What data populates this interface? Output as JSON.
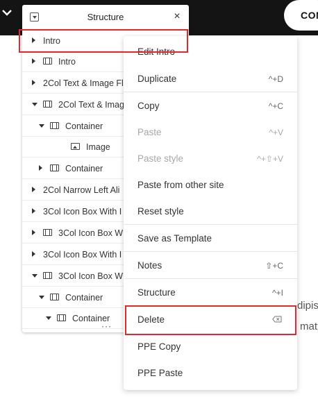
{
  "topbar": {
    "con_label": "CON"
  },
  "structure_panel": {
    "title": "Structure",
    "close_glyph": "×",
    "more_glyph": "···",
    "rows": [
      {
        "label": "Intro",
        "arrow": "right",
        "icon": "none",
        "highlighted": true
      },
      {
        "label": "Intro",
        "arrow": "right",
        "icon": "section"
      },
      {
        "label": "2Col Text & Image Fl",
        "arrow": "right",
        "icon": "none"
      },
      {
        "label": "2Col Text & Imag",
        "arrow": "down",
        "icon": "section"
      },
      {
        "label": "Container",
        "arrow": "down",
        "icon": "section"
      },
      {
        "label": "Image",
        "arrow": "none",
        "icon": "image"
      },
      {
        "label": "Container",
        "arrow": "right",
        "icon": "section"
      },
      {
        "label": "2Col Narrow Left Ali",
        "arrow": "right",
        "icon": "none"
      },
      {
        "label": "3Col Icon Box With I",
        "arrow": "right",
        "icon": "none"
      },
      {
        "label": "3Col Icon Box W",
        "arrow": "right",
        "icon": "section"
      },
      {
        "label": "3Col Icon Box With I",
        "arrow": "right",
        "icon": "none"
      },
      {
        "label": "3Col Icon Box W",
        "arrow": "down",
        "icon": "section"
      },
      {
        "label": "Container",
        "arrow": "down",
        "icon": "section"
      },
      {
        "label": "Container",
        "arrow": "down",
        "icon": "section"
      }
    ]
  },
  "context_menu": {
    "items": [
      {
        "label": "Edit Intro",
        "shortcut": "",
        "disabled": false
      },
      {
        "label": "Duplicate",
        "shortcut": "^+D",
        "disabled": false
      },
      {
        "label": "Copy",
        "shortcut": "^+C",
        "disabled": false
      },
      {
        "label": "Paste",
        "shortcut": "^+V",
        "disabled": true
      },
      {
        "label": "Paste style",
        "shortcut": "^+⇧+V",
        "disabled": true
      },
      {
        "label": "Paste from other site",
        "shortcut": "",
        "disabled": false
      },
      {
        "label": "Reset style",
        "shortcut": "",
        "disabled": false
      },
      {
        "label": "Save as Template",
        "shortcut": "",
        "disabled": false
      },
      {
        "label": "Notes",
        "shortcut": "⇧+C",
        "disabled": false
      },
      {
        "label": "Structure",
        "shortcut": "^+I",
        "disabled": false
      },
      {
        "label": "Delete",
        "shortcut": "delete-key-icon",
        "disabled": false,
        "highlighted": true
      },
      {
        "label": "PPE Copy",
        "shortcut": "",
        "disabled": false
      },
      {
        "label": "PPE Paste",
        "shortcut": "",
        "disabled": false
      }
    ]
  },
  "background_text": {
    "line1": "dipis",
    "line2": "mat"
  },
  "colors": {
    "highlight": "#e0282e",
    "topbar": "#141414"
  }
}
